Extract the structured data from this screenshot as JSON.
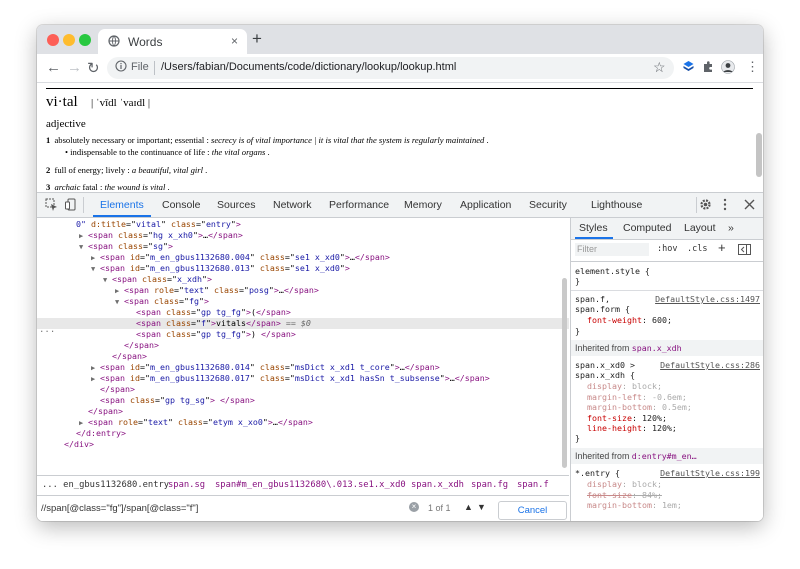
{
  "browser": {
    "tab_title": "Words",
    "tab_close": "×",
    "new_tab": "+",
    "back": "←",
    "forward": "→",
    "reload": "↻",
    "file_label": "File",
    "url": "/Users/fabian/Documents/code/dictionary/lookup/lookup.html",
    "star": "☆",
    "menu": "⋮"
  },
  "page": {
    "headword": "vi·tal",
    "pronunciation": "| ˈvīdl ˈvaɪdl |",
    "part_of_speech": "adjective",
    "defs": [
      {
        "num": "1",
        "text": "absolutely necessary or important; essential : ",
        "example": "secrecy is of vital importance | it is vital that the system is regularly maintained",
        "end": " ."
      },
      {
        "num": "2",
        "text": "full of energy; lively : ",
        "example": "a beautiful, vital girl",
        "end": " ."
      },
      {
        "num": "3",
        "text": "",
        "label": "archaic",
        "text2": " fatal : ",
        "example": "the wound is vital",
        "end": " ."
      }
    ],
    "subdef": {
      "bullet": "•",
      "text": "indispensable to the continuance of life : ",
      "example": "the vital organs",
      "end": " ."
    }
  },
  "devtools": {
    "tabs": [
      "Elements",
      "Console",
      "Sources",
      "Network",
      "Performance",
      "Memory",
      "Application",
      "Security",
      "Lighthouse"
    ],
    "active_tab": "Elements",
    "dom_lines": [
      {
        "indent": 0,
        "tri": "",
        "parts": [
          [
            "tv",
            "0\""
          ],
          [
            "ta",
            " d:title"
          ],
          [
            "tt",
            "=\""
          ],
          [
            "tv",
            "vital"
          ],
          [
            "tt",
            "\""
          ],
          [
            "ta",
            " class"
          ],
          [
            "tt",
            "=\""
          ],
          [
            "tv",
            "entry"
          ],
          [
            "tt",
            "\""
          ],
          [
            "tag",
            ">"
          ]
        ]
      },
      {
        "indent": 1,
        "tri": "▶",
        "parts": [
          [
            "tag",
            "<span"
          ],
          [
            "ta",
            " class"
          ],
          [
            "tt",
            "=\""
          ],
          [
            "tv",
            "hg x_xh0"
          ],
          [
            "tt",
            "\""
          ],
          [
            "tag",
            ">"
          ],
          [
            "tt",
            "…"
          ],
          [
            "tag",
            "</span>"
          ]
        ]
      },
      {
        "indent": 1,
        "tri": "▼",
        "parts": [
          [
            "tag",
            "<span"
          ],
          [
            "ta",
            " class"
          ],
          [
            "tt",
            "=\""
          ],
          [
            "tv",
            "sg"
          ],
          [
            "tt",
            "\""
          ],
          [
            "tag",
            ">"
          ]
        ]
      },
      {
        "indent": 2,
        "tri": "▶",
        "parts": [
          [
            "tag",
            "<span"
          ],
          [
            "ta",
            " id"
          ],
          [
            "tt",
            "=\""
          ],
          [
            "tv",
            "m_en_gbus1132680.004"
          ],
          [
            "tt",
            "\""
          ],
          [
            "ta",
            " class"
          ],
          [
            "tt",
            "=\""
          ],
          [
            "tv",
            "se1 x_xd0"
          ],
          [
            "tt",
            "\""
          ],
          [
            "tag",
            ">"
          ],
          [
            "tt",
            "…"
          ],
          [
            "tag",
            "</span>"
          ]
        ]
      },
      {
        "indent": 2,
        "tri": "▼",
        "parts": [
          [
            "tag",
            "<span"
          ],
          [
            "ta",
            " id"
          ],
          [
            "tt",
            "=\""
          ],
          [
            "tv",
            "m_en_gbus1132680.013"
          ],
          [
            "tt",
            "\""
          ],
          [
            "ta",
            " class"
          ],
          [
            "tt",
            "=\""
          ],
          [
            "tv",
            "se1 x_xd0"
          ],
          [
            "tt",
            "\""
          ],
          [
            "tag",
            ">"
          ]
        ]
      },
      {
        "indent": 3,
        "tri": "▼",
        "parts": [
          [
            "tag",
            "<span"
          ],
          [
            "ta",
            " class"
          ],
          [
            "tt",
            "=\""
          ],
          [
            "tv",
            "x_xdh"
          ],
          [
            "tt",
            "\""
          ],
          [
            "tag",
            ">"
          ]
        ]
      },
      {
        "indent": 4,
        "tri": "▶",
        "parts": [
          [
            "tag",
            "<span"
          ],
          [
            "ta",
            " role"
          ],
          [
            "tt",
            "=\""
          ],
          [
            "tv",
            "text"
          ],
          [
            "tt",
            "\""
          ],
          [
            "ta",
            " class"
          ],
          [
            "tt",
            "=\""
          ],
          [
            "tv",
            "posg"
          ],
          [
            "tt",
            "\""
          ],
          [
            "tag",
            ">"
          ],
          [
            "tt",
            "…"
          ],
          [
            "tag",
            "</span>"
          ]
        ]
      },
      {
        "indent": 4,
        "tri": "▼",
        "parts": [
          [
            "tag",
            "<span"
          ],
          [
            "ta",
            " class"
          ],
          [
            "tt",
            "=\""
          ],
          [
            "tv",
            "fg"
          ],
          [
            "tt",
            "\""
          ],
          [
            "tag",
            ">"
          ]
        ]
      },
      {
        "indent": 5,
        "tri": "",
        "parts": [
          [
            "tag",
            "<span"
          ],
          [
            "ta",
            " class"
          ],
          [
            "tt",
            "=\""
          ],
          [
            "tv",
            "gp tg_fg"
          ],
          [
            "tt",
            "\""
          ],
          [
            "tag",
            ">"
          ],
          [
            "tt",
            "("
          ],
          [
            "tag",
            "</span>"
          ]
        ]
      },
      {
        "indent": 5,
        "tri": "",
        "sel": true,
        "parts": [
          [
            "tag",
            "<span"
          ],
          [
            "ta",
            " class"
          ],
          [
            "tt",
            "=\""
          ],
          [
            "tv",
            "f"
          ],
          [
            "tt",
            "\""
          ],
          [
            "tag",
            ">"
          ],
          [
            "tt",
            "vitals"
          ],
          [
            "tag",
            "</span>"
          ],
          [
            "tc",
            " == $0"
          ]
        ]
      },
      {
        "indent": 5,
        "tri": "",
        "parts": [
          [
            "tag",
            "<span"
          ],
          [
            "ta",
            " class"
          ],
          [
            "tt",
            "=\""
          ],
          [
            "tv",
            "gp tg_fg"
          ],
          [
            "tt",
            "\""
          ],
          [
            "tag",
            ">"
          ],
          [
            "tt",
            ") "
          ],
          [
            "tag",
            "</span>"
          ]
        ]
      },
      {
        "indent": 4,
        "tri": "",
        "parts": [
          [
            "tag",
            "</span>"
          ]
        ]
      },
      {
        "indent": 3,
        "tri": "",
        "parts": [
          [
            "tag",
            "</span>"
          ]
        ]
      },
      {
        "indent": 2,
        "tri": "▶",
        "parts": [
          [
            "tag",
            "<span"
          ],
          [
            "ta",
            " id"
          ],
          [
            "tt",
            "=\""
          ],
          [
            "tv",
            "m_en_gbus1132680.014"
          ],
          [
            "tt",
            "\""
          ],
          [
            "ta",
            " class"
          ],
          [
            "tt",
            "=\""
          ],
          [
            "tv",
            "msDict x_xd1 t_core"
          ],
          [
            "tt",
            "\""
          ],
          [
            "tag",
            ">"
          ],
          [
            "tt",
            "…"
          ],
          [
            "tag",
            "</span>"
          ]
        ]
      },
      {
        "indent": 2,
        "tri": "▶",
        "parts": [
          [
            "tag",
            "<span"
          ],
          [
            "ta",
            " id"
          ],
          [
            "tt",
            "=\""
          ],
          [
            "tv",
            "m_en_gbus1132680.017"
          ],
          [
            "tt",
            "\""
          ],
          [
            "ta",
            " class"
          ],
          [
            "tt",
            "=\""
          ],
          [
            "tv",
            "msDict x_xd1 hasSn t_subsense"
          ],
          [
            "tt",
            "\""
          ],
          [
            "tag",
            ">"
          ],
          [
            "tt",
            "…"
          ],
          [
            "tag",
            "</span>"
          ]
        ]
      },
      {
        "indent": 2,
        "tri": "",
        "parts": [
          [
            "tag",
            "</span>"
          ]
        ]
      },
      {
        "indent": 2,
        "tri": "",
        "parts": [
          [
            "tag",
            "<span"
          ],
          [
            "ta",
            " class"
          ],
          [
            "tt",
            "=\""
          ],
          [
            "tv",
            "gp tg_sg"
          ],
          [
            "tt",
            "\""
          ],
          [
            "tag",
            ">"
          ],
          [
            "tt",
            " "
          ],
          [
            "tag",
            "</span>"
          ]
        ]
      },
      {
        "indent": 1,
        "tri": "",
        "parts": [
          [
            "tag",
            "</span>"
          ]
        ]
      },
      {
        "indent": 1,
        "tri": "▶",
        "parts": [
          [
            "tag",
            "<span"
          ],
          [
            "ta",
            " role"
          ],
          [
            "tt",
            "=\""
          ],
          [
            "tv",
            "text"
          ],
          [
            "tt",
            "\""
          ],
          [
            "ta",
            " class"
          ],
          [
            "tt",
            "=\""
          ],
          [
            "tv",
            "etym x_xo0"
          ],
          [
            "tt",
            "\""
          ],
          [
            "tag",
            ">"
          ],
          [
            "tt",
            "…"
          ],
          [
            "tag",
            "</span>"
          ]
        ]
      },
      {
        "indent": 0,
        "tri": "",
        "parts": [
          [
            "tag",
            "</d:entry>"
          ]
        ]
      },
      {
        "indent": -1,
        "tri": "",
        "parts": [
          [
            "tag",
            "</div>"
          ]
        ]
      }
    ],
    "dots": "...",
    "breadcrumbs": [
      "... en_gbus1132680.entry",
      "span.sg",
      "span#m_en_gbus1132680\\.013.se1.x_xd0",
      "span.x_xdh",
      "span.fg",
      "span.f"
    ],
    "search": {
      "value": "//span[@class=\"fg\"]/span[@class=\"f\"]",
      "count": "1 of 1",
      "cancel": "Cancel"
    },
    "styles": {
      "tabs": [
        "Styles",
        "Computed",
        "Layout",
        "»"
      ],
      "filter_placeholder": "Filter",
      "hov": ":hov",
      "cls": ".cls",
      "plus": "+",
      "element_style": "element.style {",
      "close_brace": "}",
      "rule1_selector": "span.f,",
      "rule1_selector2": "span.form {",
      "rule1_source": "DefaultStyle.css:1497",
      "rule1_prop": "font-weight",
      "rule1_val": "600;",
      "inherited1_label": "Inherited from ",
      "inherited1_sel": "span.x_xdh",
      "rule2_selector": "span.x_xd0 >",
      "rule2_selector2": "span.x_xdh {",
      "rule2_source": "DefaultStyle.css:286",
      "rule2_props": [
        {
          "p": "display",
          "v": "block;",
          "inh": true,
          "strike": false
        },
        {
          "p": "margin-left",
          "v": "-0.6em;",
          "inh": true,
          "strike": false
        },
        {
          "p": "margin-bottom",
          "v": "0.5em;",
          "inh": true,
          "strike": false
        },
        {
          "p": "font-size",
          "v": "120%;",
          "inh": false,
          "strike": false
        },
        {
          "p": "line-height",
          "v": "120%;",
          "inh": false,
          "strike": false
        }
      ],
      "inherited2_label": "Inherited from ",
      "inherited2_sel": "d:entry#m_en…",
      "rule3_selector": "*.entry {",
      "rule3_source": "DefaultStyle.css:199",
      "rule3_props": [
        {
          "p": "display",
          "v": "block;",
          "inh": true,
          "strike": false
        },
        {
          "p": "font-size",
          "v": "84%;",
          "inh": true,
          "strike": true
        },
        {
          "p": "margin-bottom",
          "v": "1em;",
          "inh": true,
          "strike": false
        }
      ]
    }
  }
}
